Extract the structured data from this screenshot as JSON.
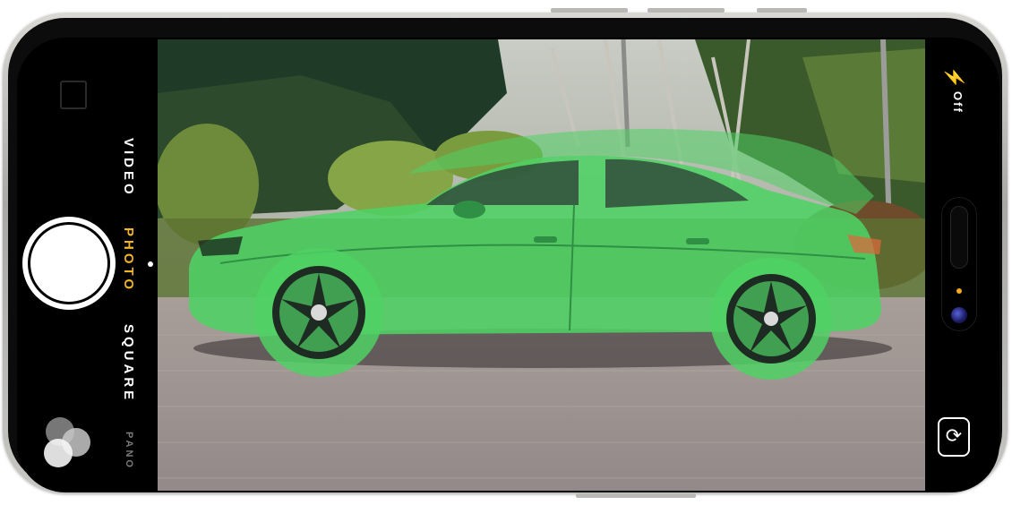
{
  "camera": {
    "modes": [
      "VIDEO",
      "PHOTO",
      "SQUARE",
      "PANO"
    ],
    "selected_mode": "PHOTO",
    "flash_label": "Off",
    "flash_icon": "lightning-bolt-icon",
    "shutter_icon": "shutter-button-icon",
    "switch_camera_icon": "camera-flip-icon",
    "filters_icon": "filters-icon"
  },
  "overlay": {
    "color": "#4fd164",
    "subject": "car"
  }
}
